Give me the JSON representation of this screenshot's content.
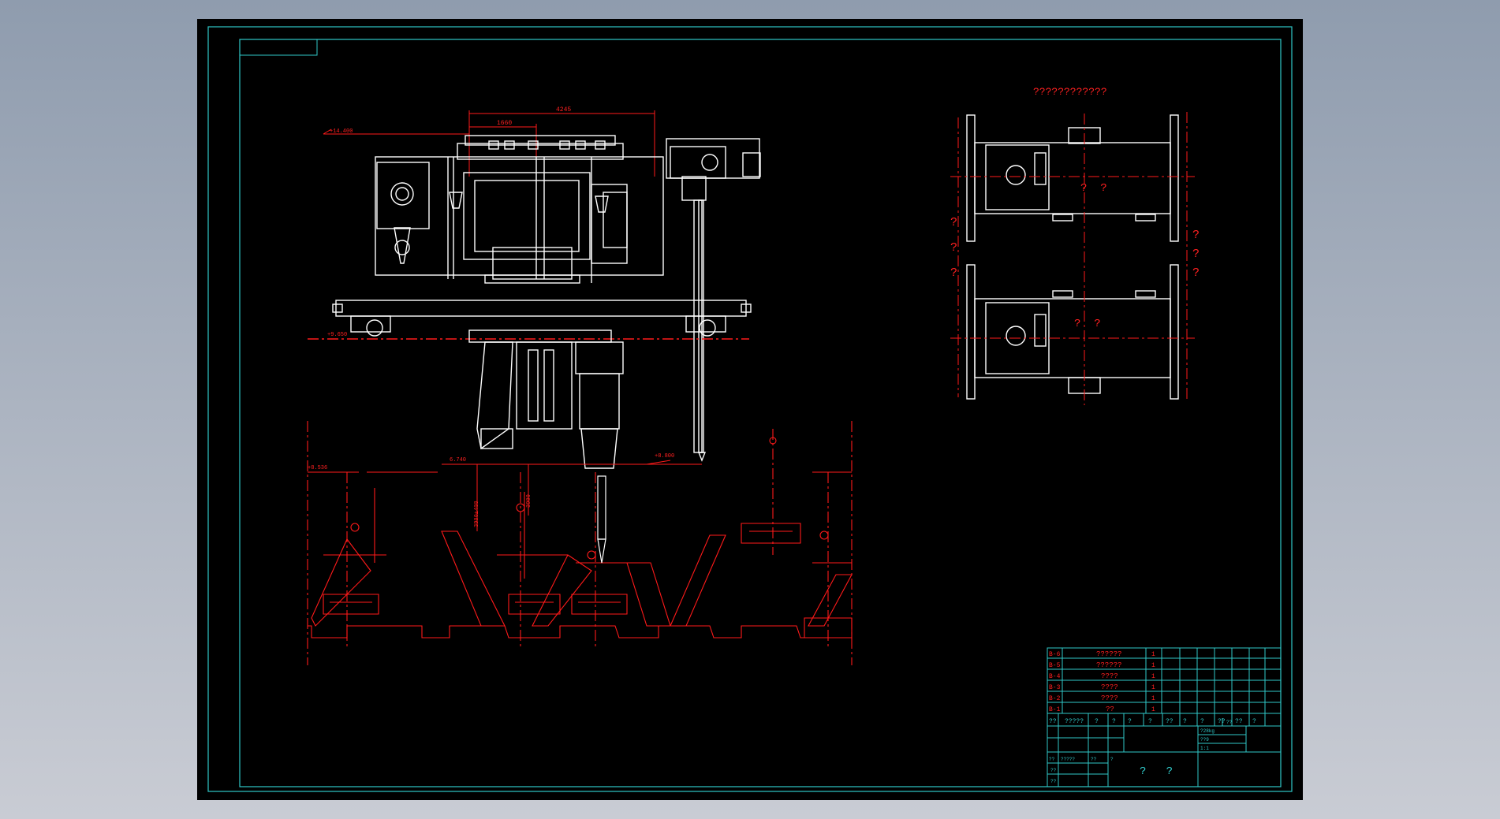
{
  "drawing": {
    "top_view_title": "????????????",
    "top_view_marks_left": [
      "?",
      "?",
      "?"
    ],
    "top_view_marks_right": [
      "?",
      "?",
      "?"
    ],
    "top_view_center_upper": "?  ?",
    "top_view_center_lower": "?  ?"
  },
  "dimensions": {
    "top_width": "4245",
    "inner_width": "1660",
    "elev_top": "+14.400",
    "elev_rail": "+9.650",
    "elev_left_ground": "+8.536",
    "elev_bottom": "6.740",
    "elev_right": "+8.800",
    "vert_a": "3900±400",
    "vert_b": "3900"
  },
  "parts_list": [
    {
      "code": "B-6",
      "name": "??????",
      "qty": "1"
    },
    {
      "code": "B-5",
      "name": "??????",
      "qty": "1"
    },
    {
      "code": "B-4",
      "name": "????",
      "qty": "1"
    },
    {
      "code": "B-3",
      "name": "????",
      "qty": "1"
    },
    {
      "code": "B-2",
      "name": "????",
      "qty": "1"
    },
    {
      "code": "B-1",
      "name": "??",
      "qty": "1"
    }
  ],
  "title_block": {
    "header": [
      "??",
      "?????",
      "?",
      "?",
      "?",
      "?",
      "??",
      "?",
      "?",
      "??",
      "??",
      "?"
    ],
    "row_a": [
      "??",
      "?????",
      "??",
      "?"
    ],
    "row_b": [
      "??"
    ],
    "row_c": [
      "??"
    ],
    "right_a": "?28kg",
    "right_b": "??9",
    "right_c": "1:1",
    "right_d": "??",
    "drawing_name": "?   ?"
  }
}
